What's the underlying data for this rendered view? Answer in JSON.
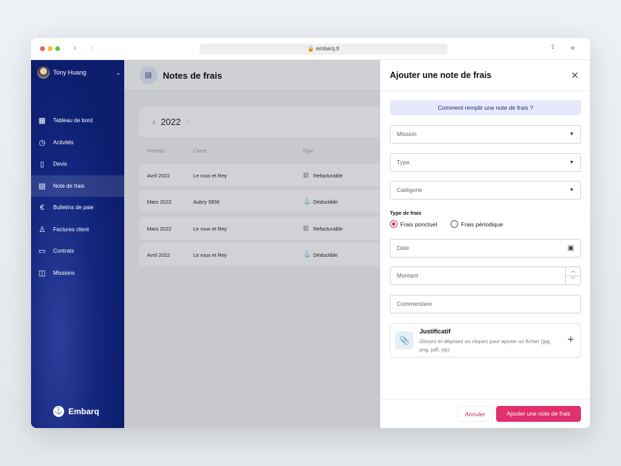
{
  "browser": {
    "url": "embarq.fr"
  },
  "sidebar": {
    "user": "Tony Huang",
    "brand": "Embarq",
    "items": [
      {
        "label": "Tableau de bord",
        "icon": "dashboard-icon"
      },
      {
        "label": "Activités",
        "icon": "calendar-clock-icon"
      },
      {
        "label": "Devis",
        "icon": "quote-document-icon"
      },
      {
        "label": "Note de frais",
        "icon": "document-icon",
        "active": true
      },
      {
        "label": "Bulletins de paie",
        "icon": "euro-icon"
      },
      {
        "label": "Factures client",
        "icon": "client-icon"
      },
      {
        "label": "Contrats",
        "icon": "folder-icon"
      },
      {
        "label": "Missions",
        "icon": "briefcase-icon"
      }
    ]
  },
  "main": {
    "title": "Notes de frais",
    "year": "2022",
    "columns": [
      "Période",
      "Client",
      "Type"
    ],
    "rows": [
      {
        "period": "Avril 2022",
        "client": "Le roux et Rey",
        "type": "Refacturable"
      },
      {
        "period": "Mars 2022",
        "client": "Aubry SEM",
        "type": "Déductible"
      },
      {
        "period": "Mars 2022",
        "client": "Le roux et Rey",
        "type": "Refacturable"
      },
      {
        "period": "Avril 2022",
        "client": "Le roux et Rey",
        "type": "Déductible"
      }
    ]
  },
  "panel": {
    "title": "Ajouter une note de frais",
    "help": "Comment remplir une note de frais ?",
    "mission": "Mission",
    "type": "Type",
    "category": "Catégorie",
    "frais_label": "Type de frais",
    "radio_ponctuel": "Frais ponctuel",
    "radio_periodique": "Frais périodique",
    "date": "Date",
    "amount": "Montant",
    "comment": "Commentaire",
    "upload_title": "Justificatif",
    "upload_desc": "Glissez et déposez ou cliquez pour ajouter un fichier (jpg, png, pdf, zip)",
    "cancel": "Annuler",
    "submit": "Ajouter une note de frais"
  },
  "colors": {
    "accent": "#e0306d",
    "sidebar": "#142780"
  }
}
